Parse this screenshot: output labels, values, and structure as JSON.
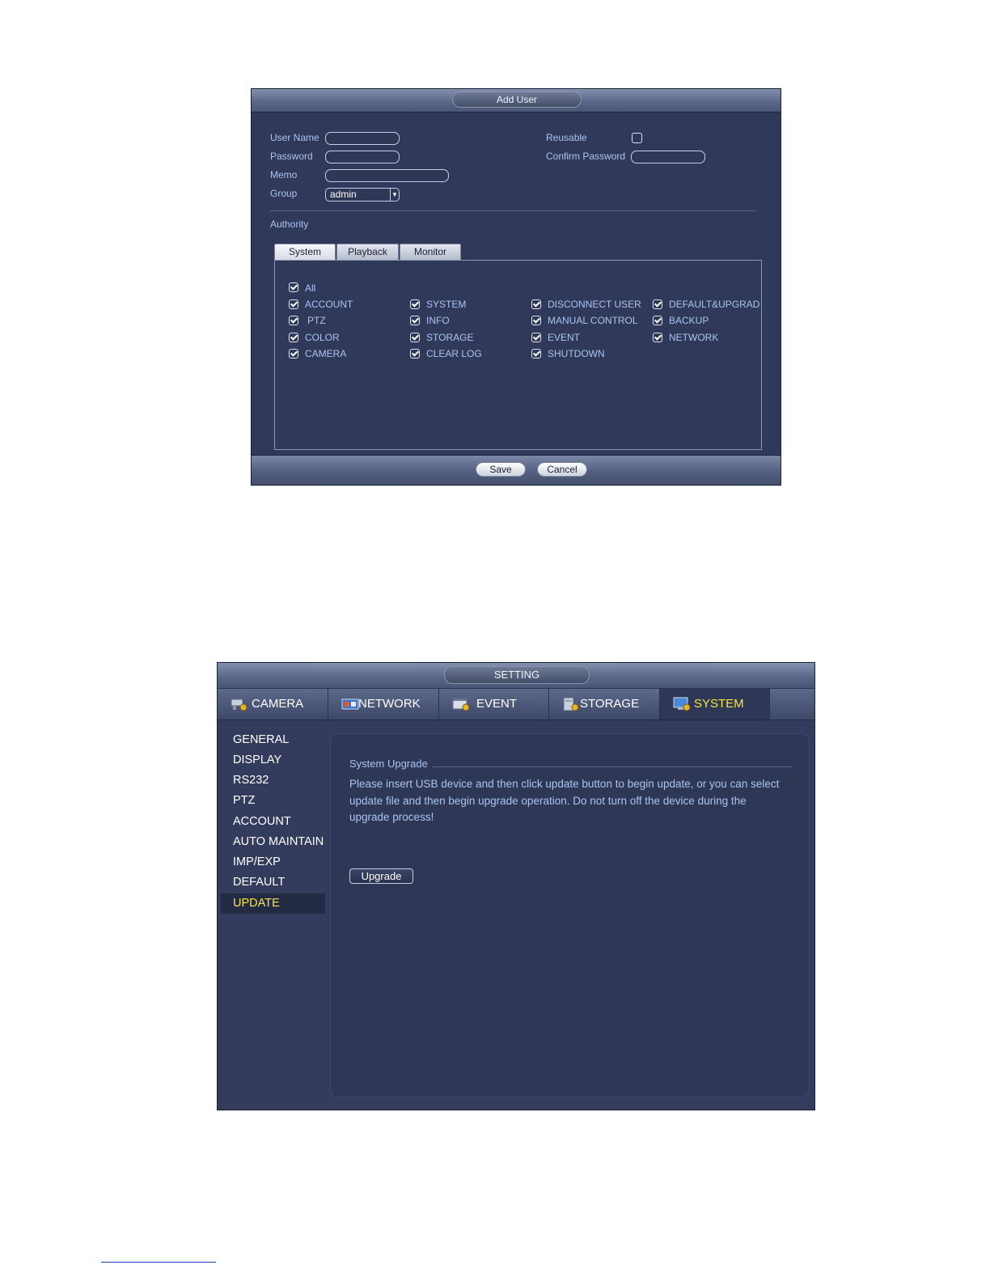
{
  "add_user": {
    "title": "Add User",
    "fields": {
      "user_name_label": "User Name",
      "password_label": "Password",
      "memo_label": "Memo",
      "group_label": "Group",
      "group_value": "admin",
      "reusable_label": "Reusable",
      "reusable_checked": false,
      "confirm_password_label": "Confirm Password"
    },
    "authority_label": "Authority",
    "tabs": [
      {
        "label": "System",
        "active": true
      },
      {
        "label": "Playback",
        "active": false
      },
      {
        "label": "Monitor",
        "active": false
      }
    ],
    "all_label": "All",
    "permissions": [
      [
        "ACCOUNT",
        "SYSTEM",
        "DISCONNECT USER",
        "DEFAULT&UPGRAD"
      ],
      [
        "PTZ",
        "INFO",
        "MANUAL CONTROL",
        "BACKUP"
      ],
      [
        "COLOR",
        "STORAGE",
        "EVENT",
        "NETWORK"
      ],
      [
        "CAMERA",
        "CLEAR LOG",
        "SHUTDOWN"
      ]
    ],
    "buttons": {
      "save": "Save",
      "cancel": "Cancel"
    }
  },
  "setting": {
    "title": "SETTING",
    "tabs": [
      {
        "label": "CAMERA",
        "icon": "camera-icon"
      },
      {
        "label": "NETWORK",
        "icon": "network-icon"
      },
      {
        "label": "EVENT",
        "icon": "event-icon"
      },
      {
        "label": "STORAGE",
        "icon": "storage-icon"
      },
      {
        "label": "SYSTEM",
        "icon": "system-icon",
        "active": true
      }
    ],
    "sidebar": [
      "GENERAL",
      "DISPLAY",
      "RS232",
      "PTZ",
      "ACCOUNT",
      "AUTO MAINTAIN",
      "IMP/EXP",
      "DEFAULT",
      "UPDATE"
    ],
    "sidebar_active": "UPDATE",
    "section_title": "System Upgrade",
    "description_lines": [
      "Please insert USB device and then click update button to begin update, or you can select",
      "update file and then begin upgrade operation. Do not turn off the device during the",
      "upgrade process!"
    ],
    "upgrade_button": "Upgrade"
  },
  "colors": {
    "panel_bg": "#31395a",
    "label_blue": "#a9c4ef",
    "active_yellow": "#f3e545"
  }
}
